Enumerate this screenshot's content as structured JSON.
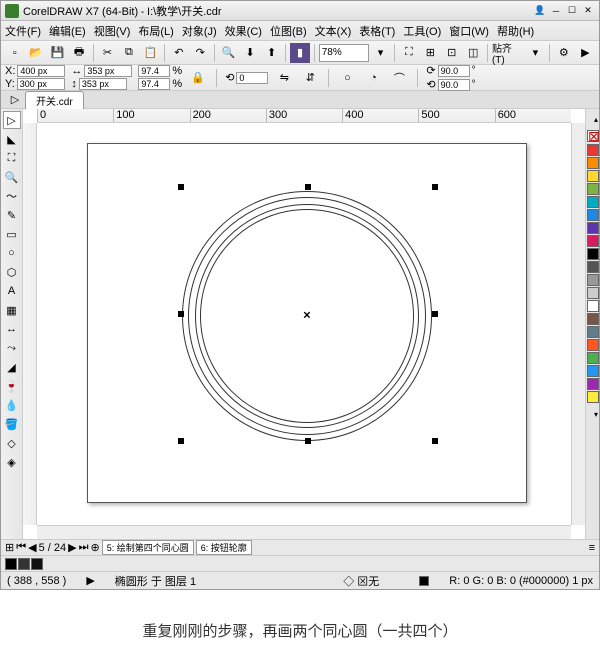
{
  "titlebar": {
    "app": "CorelDRAW X7 (64-Bit)",
    "file": "I:\\教学\\开关.cdr"
  },
  "menu": [
    "文件(F)",
    "编辑(E)",
    "视图(V)",
    "布局(L)",
    "对象(J)",
    "效果(C)",
    "位图(B)",
    "文本(X)",
    "表格(T)",
    "工具(O)",
    "窗口(W)",
    "帮助(H)"
  ],
  "zoom": "78%",
  "snap": "贴齐(T)",
  "prop": {
    "x": "400 px",
    "y": "300 px",
    "w": "353 px",
    "h": "353 px",
    "sx": "97.4",
    "sy": "97.4",
    "rot": "0",
    "a1": "90.0",
    "a2": "90.0"
  },
  "tab": "开关.cdr",
  "ruler_marks": [
    "0",
    "100",
    "200",
    "300",
    "400",
    "500",
    "600"
  ],
  "page_nav": {
    "pos": "5 / 24",
    "p5": "5: 绘制第四个同心圆",
    "p6": "6: 按钮轮廓"
  },
  "status": {
    "coords": "( 388 , 558 )",
    "shape": "椭圆形 于 图层 1",
    "fill": "无",
    "stroke": "R: 0 G: 0 B: 0 (#000000) 1 px"
  },
  "palette": [
    "#000",
    "#fff",
    "#00a",
    "#0a0",
    "#a00",
    "#aa0",
    "#a0a",
    "#0aa",
    "#888"
  ],
  "caption": "重复刚刚的步骤，再画两个同心圆（一共四个）",
  "colors": [
    "#e53935",
    "#fb8c00",
    "#fdd835",
    "#7cb342",
    "#00acc1",
    "#1e88e5",
    "#5e35b1",
    "#d81b60",
    "#000",
    "#555",
    "#999",
    "#ccc",
    "#fff",
    "#795548",
    "#607d8b",
    "#ff5722",
    "#4caf50",
    "#2196f3",
    "#9c27b0",
    "#ffeb3b"
  ]
}
